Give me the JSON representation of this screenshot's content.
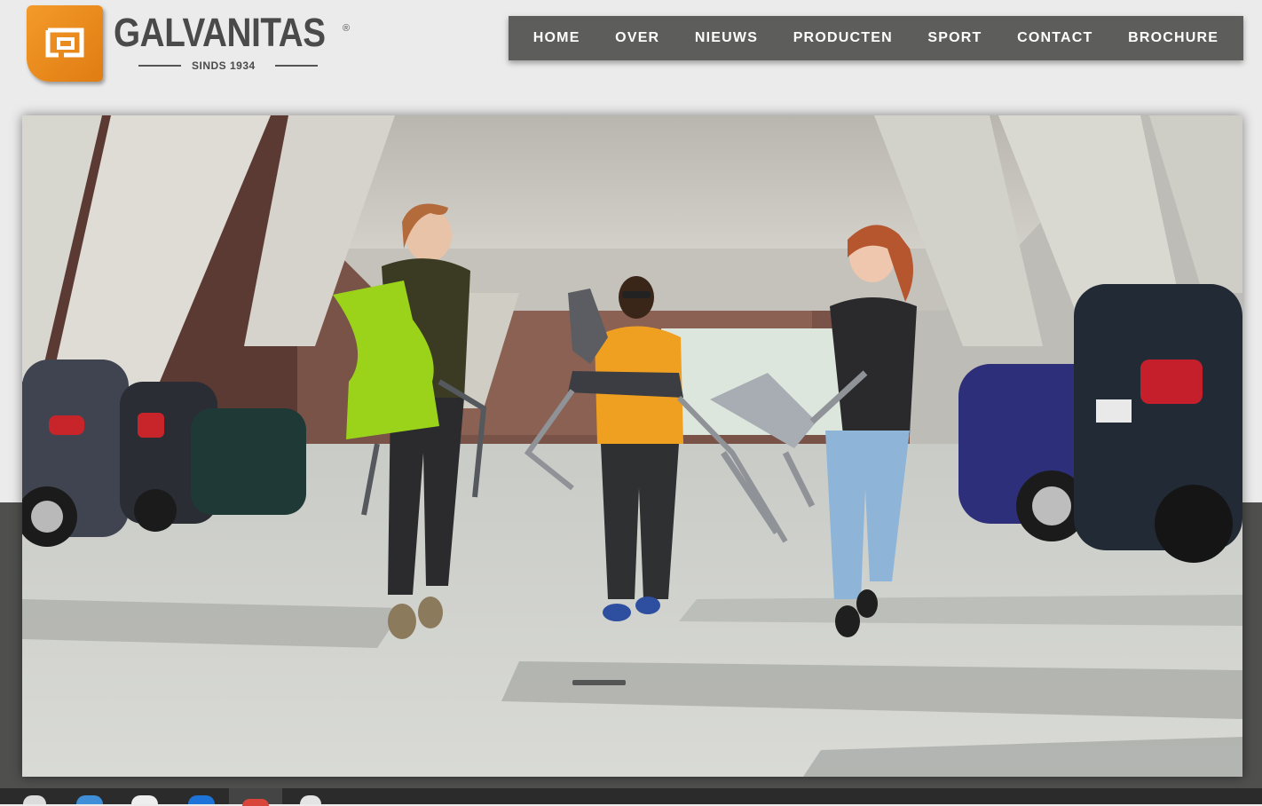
{
  "logo": {
    "brand": "GALVANITAS",
    "registered": "®",
    "since": "SINDS 1934",
    "icon": "galvanitas-logo-icon"
  },
  "nav": {
    "items": [
      {
        "label": "HOME"
      },
      {
        "label": "OVER"
      },
      {
        "label": "NIEUWS"
      },
      {
        "label": "PRODUCTEN"
      },
      {
        "label": "SPORT"
      },
      {
        "label": "CONTACT"
      },
      {
        "label": "BROCHURE"
      }
    ]
  },
  "colors": {
    "accent": "#f39a2a",
    "nav_bg": "#5d5e5b",
    "page_bg": "#ebebeb",
    "band_bg": "#4f4f4d",
    "chair_green": "#9bd31a",
    "jacket_orange": "#f0a020"
  },
  "hero": {
    "icon": "hero-photo-students-carrying-chairs"
  },
  "taskbar": {
    "icons": [
      "search-icon",
      "app-icon",
      "app-icon",
      "app-icon",
      "browser-icon",
      "app-icon"
    ]
  }
}
